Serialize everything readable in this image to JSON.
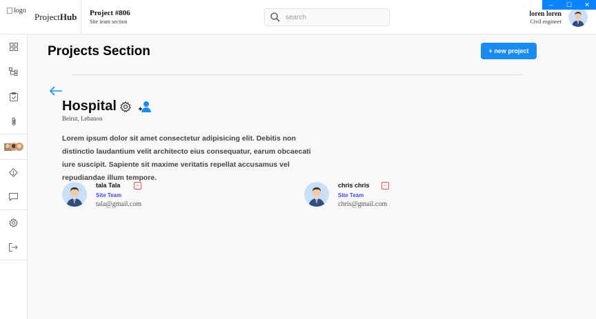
{
  "window": {
    "minimize": "–",
    "maximize": "☐",
    "close": "✕"
  },
  "header": {
    "logo_alt": "logo",
    "brand_prefix": "Project",
    "brand_bold": "Hub",
    "project_title": "Project #806",
    "project_subtitle": "Site team section",
    "search_placeholder": "search",
    "user_name": "loren loren",
    "user_role": "Civil engineer"
  },
  "sidebar": {
    "icons": [
      "dashboard-icon",
      "hierarchy-icon",
      "clipboard-icon",
      "paperclip-icon",
      "team-avatars-icon",
      "warning-icon",
      "chat-icon",
      "settings-icon",
      "logout-icon"
    ]
  },
  "main": {
    "page_title": "Projects Section",
    "new_project_label": "+ new project",
    "project_name": "Hospital",
    "location": "Beirut, Lebanon",
    "description": "Lorem ipsum dolor sit amet consectetur adipisicing elit. Debitis non distinctio laudantium velit architecto eius consequatur, earum obcaecati iure suscipit. Sapiente sit maxime veritatis repellat accusamus vel repudiandae illum tempore.",
    "members": [
      {
        "name": "tala Tala",
        "team": "Site Team",
        "email": "tala@gmail.com"
      },
      {
        "name": "chris chris",
        "team": "Site Team",
        "email": "chris@gmail.com"
      }
    ]
  },
  "colors": {
    "accent": "#1a8cf0",
    "team": "#4a4ae0",
    "remove": "#e25555"
  }
}
